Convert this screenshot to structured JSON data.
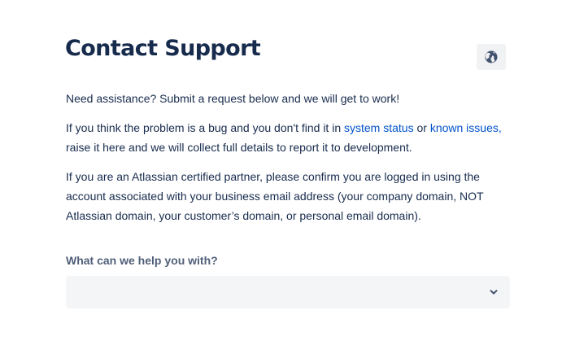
{
  "header": {
    "title": "Contact Support",
    "language_icon": "globe-icon"
  },
  "intro": {
    "line1": "Need assistance? Submit a request below and we will get to work!",
    "line2_before": "If you think the problem is a bug and you don't find it in ",
    "system_status_link": "system status",
    "line2_middle": " or ",
    "known_issues_link": "known issues,",
    "line2_after": " raise it here and we will collect full details to report it to development.",
    "line3": "If you are an Atlassian certified partner, please confirm you are logged in using the account associated with your business email address (your company domain, NOT Atlassian domain, your customer’s domain, or personal email domain)."
  },
  "form": {
    "help_label": "What can we help you with?",
    "help_select_value": "",
    "help_select_icon": "chevron-down-icon"
  },
  "colors": {
    "text": "#172b4d",
    "link": "#0052cc",
    "label": "#505f79",
    "field_bg": "#f4f5f7"
  }
}
